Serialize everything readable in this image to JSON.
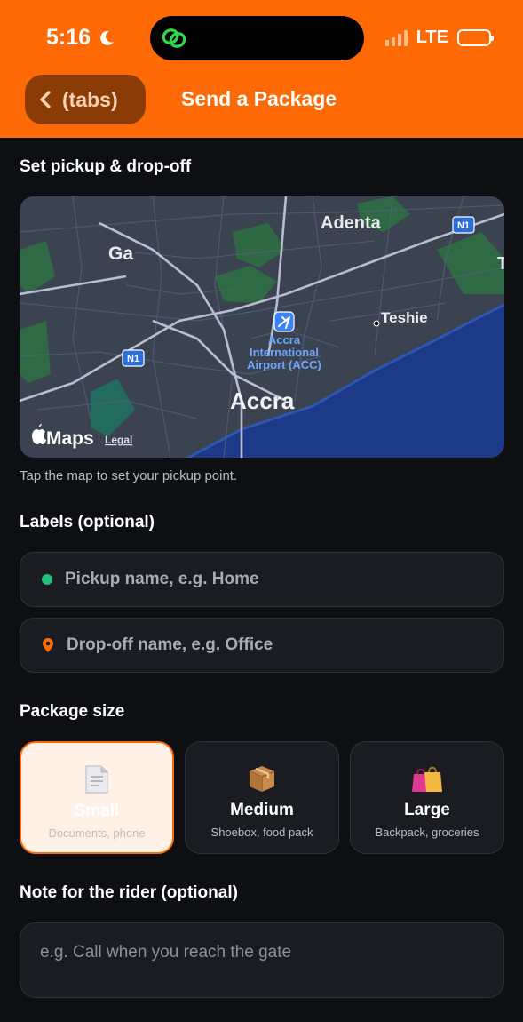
{
  "status_bar": {
    "time": "5:16",
    "network": "LTE"
  },
  "nav": {
    "back_label": "(tabs)",
    "title": "Send a Package"
  },
  "pickup_section": {
    "title": "Set pickup & drop-off",
    "map": {
      "labels": {
        "ga": "Ga",
        "adenta": "Adenta",
        "teshie": "Teshie",
        "accra": "Accra",
        "airport_line1": "Accra",
        "airport_line2": "International",
        "airport_line3": "Airport (ACC)",
        "n1_east": "N1",
        "n1_west": "N1",
        "edge_letter": "T",
        "maps_brand": "Maps",
        "legal": "Legal"
      }
    },
    "hint": "Tap the map to set your pickup point."
  },
  "labels_section": {
    "title": "Labels (optional)",
    "pickup_placeholder": "Pickup name, e.g. Home",
    "dropoff_placeholder": "Drop-off name, e.g. Office"
  },
  "package_size": {
    "title": "Package size",
    "options": [
      {
        "name": "Small",
        "desc": "Documents, phone",
        "icon": "document-icon",
        "selected": true
      },
      {
        "name": "Medium",
        "desc": "Shoebox, food pack",
        "icon": "package-box-icon",
        "selected": false
      },
      {
        "name": "Large",
        "desc": "Backpack, groceries",
        "icon": "shopping-bags-icon",
        "selected": false
      }
    ]
  },
  "note": {
    "title": "Note for the rider (optional)",
    "placeholder": "e.g. Call when you reach the gate"
  },
  "colors": {
    "accent": "#ff6a06",
    "background": "#0e0f12",
    "field": "#1a1c21",
    "green_dot": "#21c07a"
  }
}
